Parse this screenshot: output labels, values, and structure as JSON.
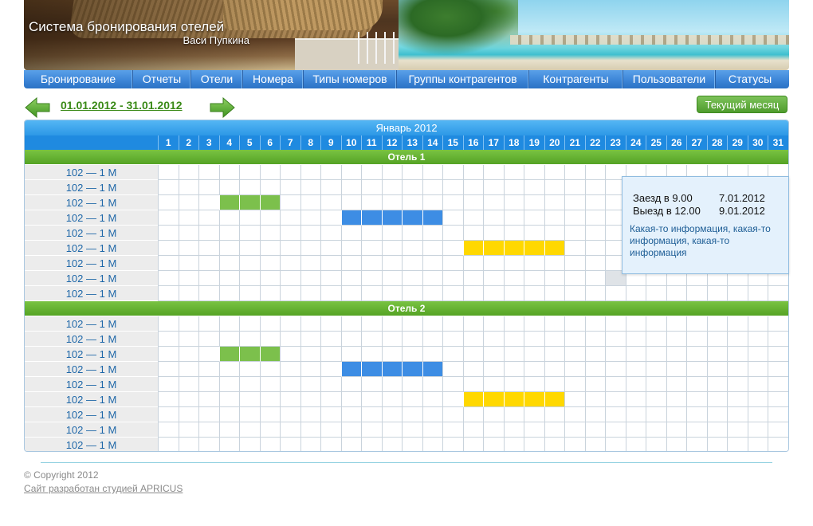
{
  "header": {
    "title": "Система бронирования отелей",
    "subtitle": "Васи Пупкина"
  },
  "nav": [
    {
      "label": "Бронирование"
    },
    {
      "label": "Отчеты"
    },
    {
      "label": "Отели"
    },
    {
      "label": "Номера"
    },
    {
      "label": "Типы номеров"
    },
    {
      "label": "Группы контрагентов"
    },
    {
      "label": "Контрагенты"
    },
    {
      "label": "Пользователи"
    },
    {
      "label": "Статусы"
    }
  ],
  "period": {
    "range": "01.01.2012 - 31.01.2012",
    "current_month_label": "Текущий месяц"
  },
  "calendar": {
    "month": "Январь 2012",
    "days": [
      "1",
      "2",
      "3",
      "4",
      "5",
      "6",
      "7",
      "8",
      "9",
      "10",
      "11",
      "12",
      "13",
      "14",
      "15",
      "16",
      "17",
      "18",
      "19",
      "20",
      "21",
      "22",
      "23",
      "24",
      "25",
      "26",
      "27",
      "28",
      "29",
      "30",
      "31"
    ],
    "hotels": [
      {
        "name": "Отель 1",
        "rooms": [
          {
            "label": "102 — 1 М",
            "bookings": []
          },
          {
            "label": "102 — 1 М",
            "bookings": []
          },
          {
            "label": "102 — 1 М",
            "bookings": [
              {
                "start": 4,
                "end": 6,
                "color": "green"
              }
            ]
          },
          {
            "label": "102 — 1 М",
            "bookings": [
              {
                "start": 10,
                "end": 14,
                "color": "blue"
              }
            ]
          },
          {
            "label": "102 — 1 М",
            "bookings": []
          },
          {
            "label": "102 — 1 М",
            "bookings": [
              {
                "start": 16,
                "end": 20,
                "color": "yellow"
              }
            ]
          },
          {
            "label": "102 — 1 М",
            "bookings": []
          },
          {
            "label": "102 — 1 М",
            "bookings": [
              {
                "start": 23,
                "end": 23,
                "color": "gray"
              }
            ]
          },
          {
            "label": "102 — 1 М",
            "bookings": []
          }
        ]
      },
      {
        "name": "Отель 2",
        "rooms": [
          {
            "label": "102 — 1 М",
            "bookings": []
          },
          {
            "label": "102 — 1 М",
            "bookings": []
          },
          {
            "label": "102 — 1 М",
            "bookings": [
              {
                "start": 4,
                "end": 6,
                "color": "green"
              }
            ]
          },
          {
            "label": "102 — 1 М",
            "bookings": [
              {
                "start": 10,
                "end": 14,
                "color": "blue"
              }
            ]
          },
          {
            "label": "102 — 1 М",
            "bookings": []
          },
          {
            "label": "102 — 1 М",
            "bookings": [
              {
                "start": 16,
                "end": 20,
                "color": "yellow"
              }
            ]
          },
          {
            "label": "102 — 1 М",
            "bookings": []
          },
          {
            "label": "102 — 1 М",
            "bookings": []
          },
          {
            "label": "102 — 1 М",
            "bookings": []
          }
        ]
      }
    ]
  },
  "tooltip": {
    "checkin_label": "Заезд в 9.00",
    "checkin_date": "7.01.2012",
    "checkout_label": "Выезд в 12.00",
    "checkout_date": "9.01.2012",
    "info": "Какая-то информация, какая-то информация, какая-то информация"
  },
  "footer": {
    "copyright": "© Copyright 2012",
    "studio": "Сайт разработан студией APRICUS"
  },
  "colors": {
    "nav_blue": "#3d86d8",
    "hotel_green": "#55a325",
    "booking_green": "#7cc04c",
    "booking_blue": "#3d8de4",
    "booking_yellow": "#ffd800",
    "link_green": "#3a8a17"
  }
}
